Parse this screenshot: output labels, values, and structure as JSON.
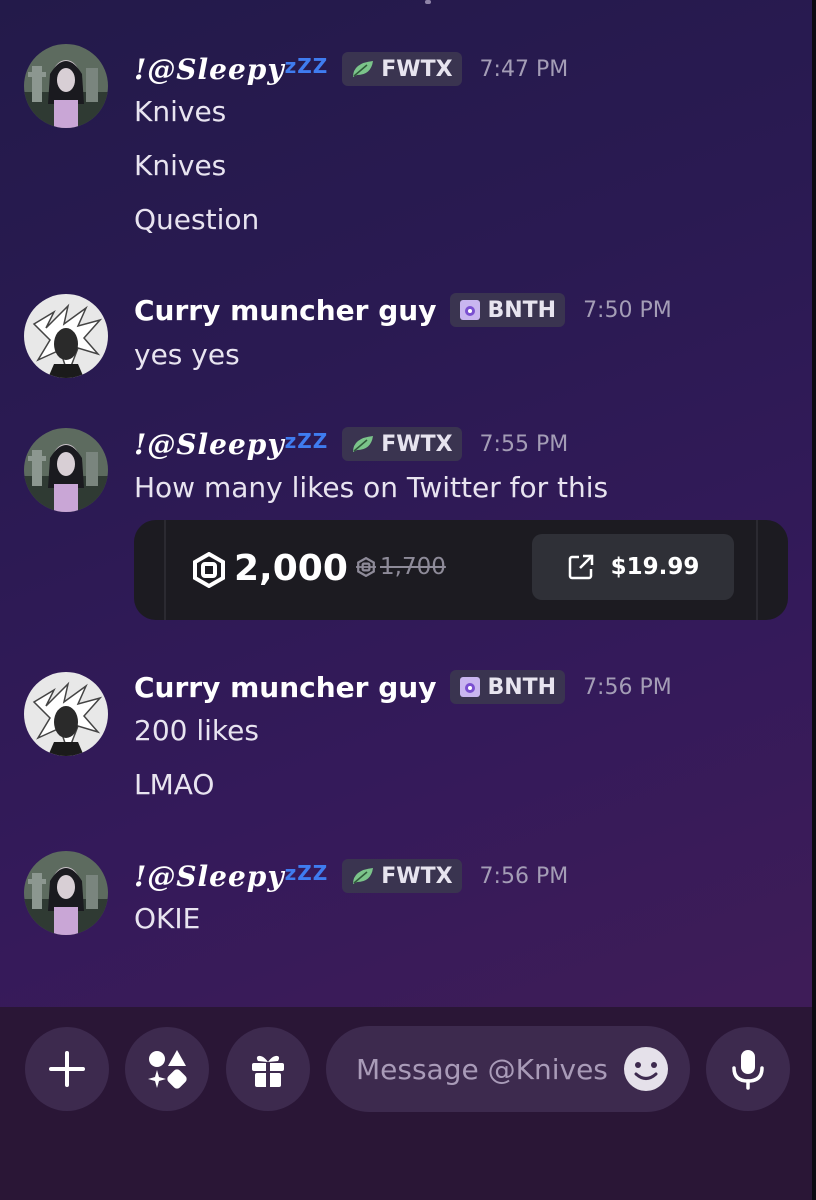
{
  "messages": [
    {
      "username": "!@Sleepy",
      "zzz": "zZZ",
      "tag": "FWTX",
      "time": "7:47 PM",
      "lines": [
        "Knives",
        "Knives",
        "Question"
      ]
    },
    {
      "username": "Curry muncher guy",
      "tag": "BNTH",
      "time": "7:50 PM",
      "lines": [
        "yes yes"
      ]
    },
    {
      "username": "!@Sleepy",
      "zzz": "zZZ",
      "tag": "FWTX",
      "time": "7:55 PM",
      "lines": [
        "How many likes on Twitter for this"
      ]
    },
    {
      "username": "Curry muncher guy",
      "tag": "BNTH",
      "time": "7:56 PM",
      "lines": [
        "200 likes",
        "LMAO"
      ]
    },
    {
      "username": "!@Sleepy",
      "zzz": "zZZ",
      "tag": "FWTX",
      "time": "7:56 PM",
      "lines": [
        "OKIE"
      ]
    }
  ],
  "product_card": {
    "amount": "2,000",
    "original_amount": "1,700",
    "price": "$19.99"
  },
  "composer": {
    "placeholder": "Message @Knives"
  },
  "icons": {
    "add": "plus-icon",
    "apps": "apps-icon",
    "gift": "gift-icon",
    "emoji": "emoji-icon",
    "mic": "microphone-icon",
    "robux": "robux-icon",
    "external": "external-link-icon",
    "fwtx_badge": "leaf-icon",
    "bnth_badge": "shield-icon"
  },
  "colors": {
    "accent_zzz": "#3f7cf0",
    "tag_bg": "#3a3450",
    "card_bg": "#1c1b21",
    "composer_bg": "#2a1636"
  }
}
